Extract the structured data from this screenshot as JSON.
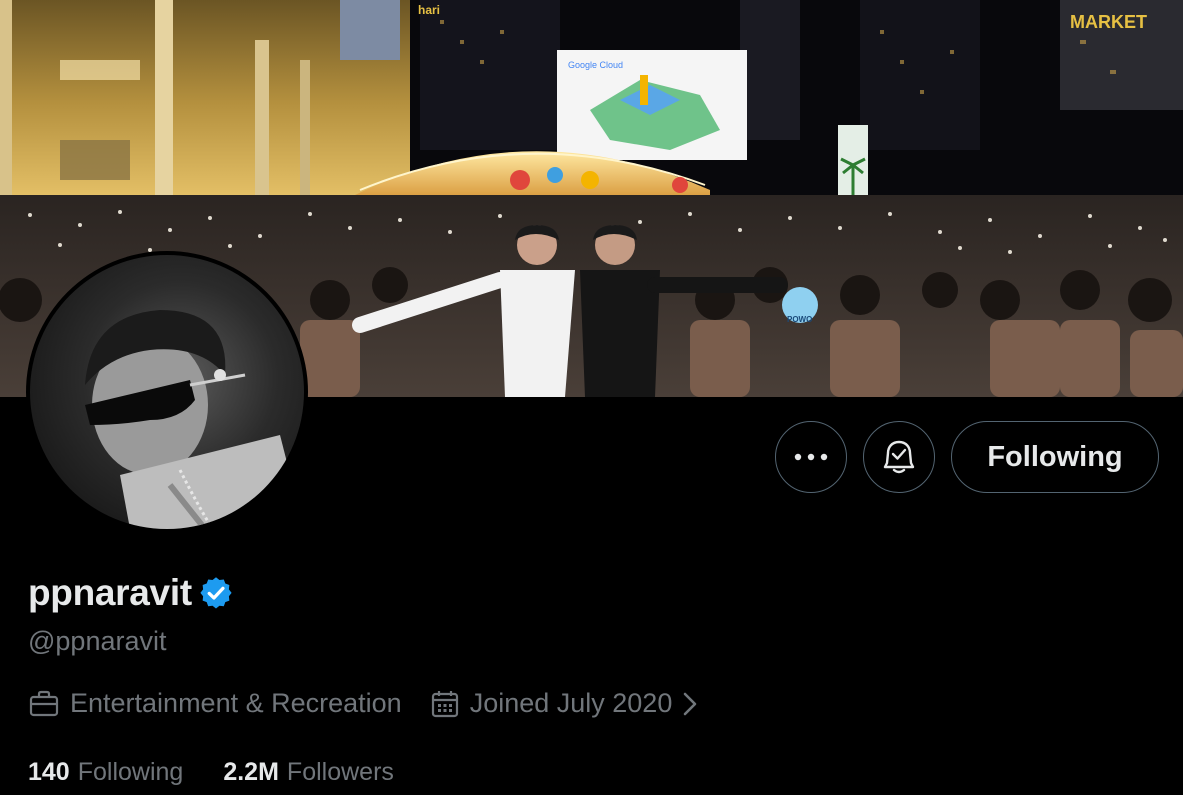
{
  "profile": {
    "display_name": "ppnaravit",
    "handle": "@ppnaravit",
    "verified": true,
    "category": "Entertainment & Recreation",
    "joined": "Joined July 2020"
  },
  "banner": {
    "screen_text": "Google Cloud",
    "sign_text": "MARKET",
    "sign_text_2": "hari",
    "fan_sign": "POWO"
  },
  "actions": {
    "following_label": "Following"
  },
  "stats": {
    "following_count": "140",
    "following_label": "Following",
    "followers_count": "2.2M",
    "followers_label": "Followers"
  },
  "colors": {
    "background": "#000000",
    "primary_text": "#e7e9ea",
    "secondary_text": "#71767b",
    "border": "#536471",
    "verified_blue": "#1d9bf0"
  }
}
